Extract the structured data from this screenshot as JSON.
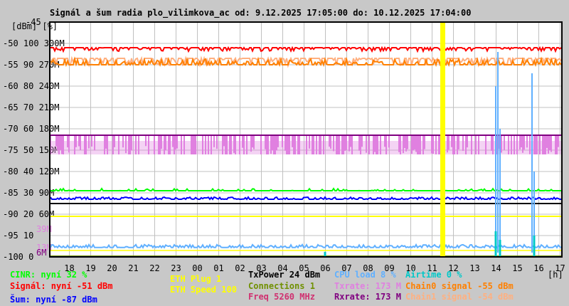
{
  "chart_data": {
    "type": "line",
    "title": "Signál a šum radia plo_vilimkova_ac od: 9.12.2025 17:05:00 do: 10.12.2025 17:04:00",
    "ylabel": "[dBm] [%]",
    "xlabel": "[h]",
    "ylim": [
      -100,
      -45
    ],
    "y_ticks": [
      {
        "dbm": "-45",
        "pct": "",
        "rate": ""
      },
      {
        "dbm": "-50",
        "pct": "100",
        "rate": "300M"
      },
      {
        "dbm": "-55",
        "pct": "90",
        "rate": "270M"
      },
      {
        "dbm": "-60",
        "pct": "80",
        "rate": "240M"
      },
      {
        "dbm": "-65",
        "pct": "70",
        "rate": "210M"
      },
      {
        "dbm": "-70",
        "pct": "60",
        "rate": "180M"
      },
      {
        "dbm": "-75",
        "pct": "50",
        "rate": "150M"
      },
      {
        "dbm": "-80",
        "pct": "40",
        "rate": "120M"
      },
      {
        "dbm": "-85",
        "pct": "30",
        "rate": "90M"
      },
      {
        "dbm": "-90",
        "pct": "20",
        "rate": "60M"
      },
      {
        "dbm": "-95",
        "pct": "10",
        "rate": ""
      },
      {
        "dbm": "-100",
        "pct": "0",
        "rate": ""
      }
    ],
    "extra_rate_labels": [
      {
        "text": "39M",
        "dbm": -93.5,
        "color": "#e080e0"
      },
      {
        "text": "13M",
        "dbm": -97.8,
        "color": "#e080e0"
      },
      {
        "text": "6M",
        "dbm": -99.0,
        "color": "#800080"
      }
    ],
    "x_ticks": [
      "18",
      "19",
      "20",
      "21",
      "22",
      "23",
      "00",
      "01",
      "02",
      "03",
      "04",
      "05",
      "06",
      "07",
      "08",
      "09",
      "10",
      "11",
      "12",
      "13",
      "14",
      "15",
      "16",
      "17"
    ],
    "x_start_offset_hours": 0.9167,
    "hours_span": 24,
    "outage_hour": 18.3,
    "series": [
      {
        "name": "Signál",
        "level": -51,
        "color": "#ff0000"
      },
      {
        "name": "Chain1 signal",
        "level": -53.5,
        "color": "#ffb080"
      },
      {
        "name": "Chain0 signal",
        "level": -55,
        "color": "#ff8000"
      },
      {
        "name": "Txrate",
        "level_high": -71.5,
        "level_low": -76,
        "color": "#e080e0"
      },
      {
        "name": "Rxrate",
        "level": -71.5,
        "color": "#800080"
      },
      {
        "name": "CINR",
        "level": -84.5,
        "color": "#00ff00"
      },
      {
        "name": "Šum",
        "level": -86.5,
        "color": "#0000ff"
      },
      {
        "name": "TxPower",
        "level": -87.5,
        "color": "#000000"
      },
      {
        "name": "ETH Speed",
        "level": -90.5,
        "color": "#ffff00"
      },
      {
        "name": "ETH Plug",
        "level": -98.5,
        "color": "#ffff00"
      },
      {
        "name": "CPU load",
        "level": -97.8,
        "color": "#60b0ff"
      },
      {
        "name": "Airtime",
        "level": -100,
        "color": "#00c8c8"
      },
      {
        "name": "Connections",
        "level": -99.8,
        "color": "#709000"
      }
    ]
  },
  "legend": [
    {
      "text": "CINR: nyní 32 %",
      "color": "#00ff00"
    },
    {
      "text": "Signál: nyní -51 dBm",
      "color": "#ff0000"
    },
    {
      "text": "Šum: nyní -87 dBm",
      "color": "#0000ff"
    },
    {
      "text": "ETH Plug 1",
      "color": "#ffff00"
    },
    {
      "text": "ETH Speed 100",
      "color": "#ffff00"
    },
    {
      "text": "TxPower 24 dBm",
      "color": "#000000"
    },
    {
      "text": "Connections 1",
      "color": "#709000"
    },
    {
      "text": "Freq 5260 MHz",
      "color": "#d03070"
    },
    {
      "text": "CPU load 8 %",
      "color": "#60b0ff"
    },
    {
      "text": "Txrate: 173 M",
      "color": "#e080e0"
    },
    {
      "text": "Rxrate: 173 M",
      "color": "#800080"
    },
    {
      "text": "Airtime 0 %",
      "color": "#00c8c8"
    },
    {
      "text": "Chain0 signal -55 dBm",
      "color": "#ff8000"
    },
    {
      "text": "Chain1 signal -54 dBm",
      "color": "#ffb080"
    }
  ]
}
